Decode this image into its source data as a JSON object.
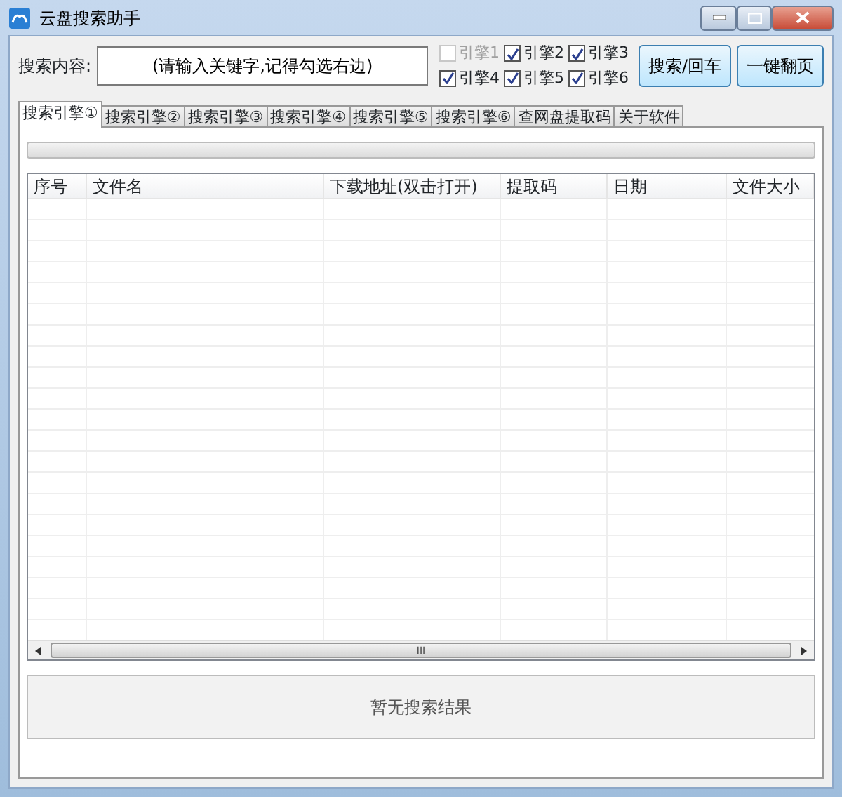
{
  "window": {
    "title": "云盘搜索助手"
  },
  "search": {
    "label": "搜索内容:",
    "value": "(请输入关键字,记得勾选右边)"
  },
  "engines": [
    {
      "label": "引擎1",
      "checked": false,
      "disabled": true
    },
    {
      "label": "引擎2",
      "checked": true,
      "disabled": false
    },
    {
      "label": "引擎3",
      "checked": true,
      "disabled": false
    },
    {
      "label": "引擎4",
      "checked": true,
      "disabled": false
    },
    {
      "label": "引擎5",
      "checked": true,
      "disabled": false
    },
    {
      "label": "引擎6",
      "checked": true,
      "disabled": false
    }
  ],
  "buttons": [
    "搜索/回车",
    "一键翻页"
  ],
  "tabs": [
    {
      "label": "搜索引擎①",
      "selected": true
    },
    {
      "label": "搜索引擎②",
      "selected": false
    },
    {
      "label": "搜索引擎③",
      "selected": false
    },
    {
      "label": "搜索引擎④",
      "selected": false
    },
    {
      "label": "搜索引擎⑤",
      "selected": false
    },
    {
      "label": "搜索引擎⑥",
      "selected": false
    },
    {
      "label": "查网盘提取码",
      "selected": false
    },
    {
      "label": "关于软件",
      "selected": false
    }
  ],
  "progress": {
    "level": 0
  },
  "table": {
    "columns": [
      "序号",
      "文件名",
      "下载地址(双击打开)",
      "提取码",
      "日期",
      "文件大小"
    ]
  },
  "scrollbar": {
    "grip": "III"
  },
  "result": {
    "text": "暂无搜索结果"
  }
}
